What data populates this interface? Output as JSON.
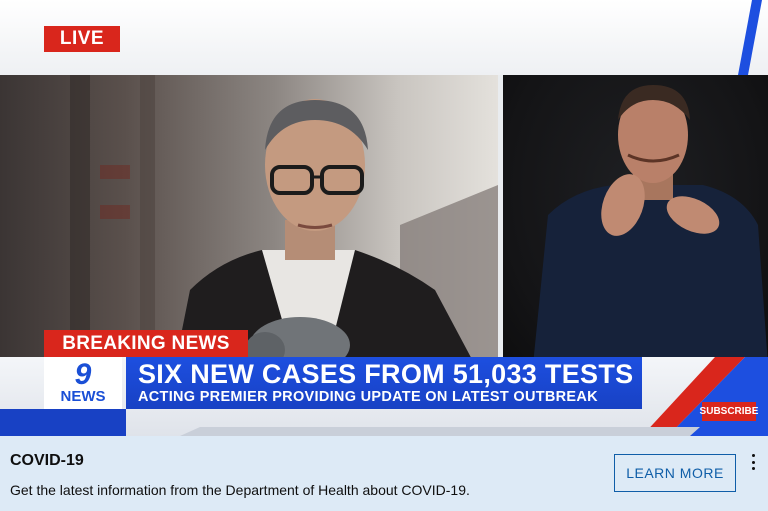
{
  "video": {
    "live_label": "LIVE",
    "breaking_label": "BREAKING NEWS",
    "channel_logo": {
      "number": "9",
      "word": "NEWS"
    },
    "headline": "SIX NEW CASES FROM 51,033 TESTS",
    "subheadline": "ACTING PREMIER PROVIDING UPDATE ON LATEST OUTBREAK",
    "subscribe_label": "SUBSCRIBE"
  },
  "info_panel": {
    "title": "COVID-19",
    "description": "Get the latest information from the Department of Health about COVID-19.",
    "button_label": "LEARN MORE",
    "menu_icon": "more-vertical-icon"
  },
  "colors": {
    "brand_red": "#d9261c",
    "brand_blue": "#1d4fe0",
    "panel_bg": "#ddeaf6",
    "link_blue": "#0f5ea8"
  }
}
